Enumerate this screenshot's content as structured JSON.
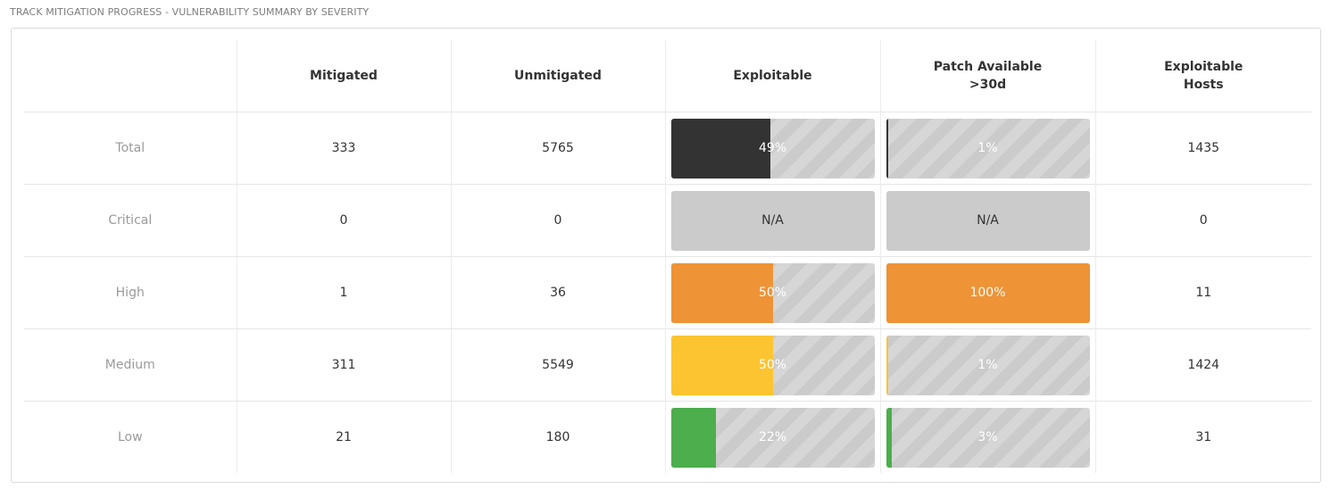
{
  "widget": {
    "title": "TRACK MITIGATION PROGRESS - VULNERABILITY SUMMARY BY SEVERITY"
  },
  "table": {
    "headers": {
      "row_label": "",
      "mitigated": "Mitigated",
      "unmitigated": "Unmitigated",
      "exploitable": "Exploitable",
      "patch_line1": "Patch Available",
      "patch_line2": ">30d",
      "hosts_line1": "Exploitable",
      "hosts_line2": "Hosts"
    },
    "rows": [
      {
        "label": "Total",
        "mitigated": "333",
        "unmitigated": "5765",
        "exploitable": {
          "text": "49%",
          "fraction": 0.49,
          "color": "#333333"
        },
        "patch": {
          "text": "1%",
          "fraction": 0.01,
          "color": "#333333"
        },
        "hosts": "1435"
      },
      {
        "label": "Critical",
        "mitigated": "0",
        "unmitigated": "0",
        "exploitable": {
          "text": "N/A",
          "fraction": 0,
          "color": "#cbcbcb"
        },
        "patch": {
          "text": "N/A",
          "fraction": 0,
          "color": "#cbcbcb"
        },
        "hosts": "0"
      },
      {
        "label": "High",
        "mitigated": "1",
        "unmitigated": "36",
        "exploitable": {
          "text": "50%",
          "fraction": 0.5,
          "color": "#ee9336"
        },
        "patch": {
          "text": "100%",
          "fraction": 1.0,
          "color": "#ee9336"
        },
        "hosts": "11"
      },
      {
        "label": "Medium",
        "mitigated": "311",
        "unmitigated": "5549",
        "exploitable": {
          "text": "50%",
          "fraction": 0.5,
          "color": "#fdc431"
        },
        "patch": {
          "text": "1%",
          "fraction": 0.01,
          "color": "#fdc431"
        },
        "hosts": "1424"
      },
      {
        "label": "Low",
        "mitigated": "21",
        "unmitigated": "180",
        "exploitable": {
          "text": "22%",
          "fraction": 0.22,
          "color": "#4cae4c"
        },
        "patch": {
          "text": "3%",
          "fraction": 0.03,
          "color": "#4cae4c"
        },
        "hosts": "31"
      }
    ]
  }
}
